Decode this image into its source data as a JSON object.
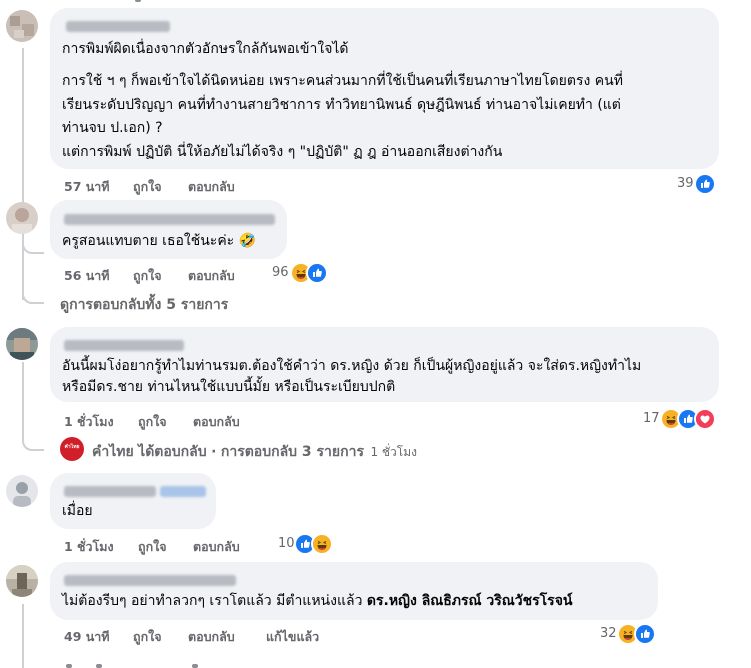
{
  "comments": [
    {
      "lines": [
        "การพิมพ์ผิดเนื่องจากตัวอักษรใกล้กันพอเข้าใจได้",
        "การใช้ ฯ ๆ ก็พอเข้าใจได้นิดหน่อย เพราะคนส่วนมากที่ใช้เป็นคนที่เรียนภาษาไทยโดยตรง คนที่",
        "เรียนระดับปริญญา คนที่ทำงานสายวิชาการ ทำวิทยานิพนธ์ ดุษฎีนิพนธ์ ท่านอาจไม่เคยทำ (แต่",
        "ท่านจบ ป.เอก) ?",
        "แต่การพิมพ์ ปฏิบัติ นี่ให้อภัยไม่ได้จริง ๆ \"ปฏิบัติ\" ฏ ฎ อ่านออกเสียงต่างกัน"
      ],
      "time": "57 นาที",
      "like": "ถูกใจ",
      "reply": "ตอบกลับ",
      "reactions": "39"
    },
    {
      "text": "ครูสอนแทบตาย เธอใช้นะค่ะ 🤣",
      "time": "56 นาที",
      "like": "ถูกใจ",
      "reply": "ตอบกลับ",
      "reactions": "96"
    },
    {
      "lines": [
        "อันนี้ผมโง่อยากรู้ทำไมท่านรมต.ต้องใช้คำว่า ดร.หญิง ด้วย ก็เป็นผู้หญิงอยู่แล้ว จะใส่ดร.หญิงทำไม",
        "หรือมีดร.ชาย ท่านไหนใช้แบบนี้มั้ย หรือเป็นระเบียบปกติ"
      ],
      "time": "1 ชั่วโมง",
      "like": "ถูกใจ",
      "reply": "ตอบกลับ",
      "reactions": "17"
    },
    {
      "text": "เมื่อย",
      "time": "1 ชั่วโมง",
      "like": "ถูกใจ",
      "reply": "ตอบกลับ",
      "reactions": "10"
    },
    {
      "text_plain": "ไม่ต้องรีบๆ อย่าทำลวกๆ เราโตแล้ว มีตำแหน่งแล้ว ",
      "text_bold": "ดร.หญิง ลิณธิภรณ์ วริณวัชรโรจน์",
      "time": "49 นาที",
      "like": "ถูกใจ",
      "reply": "ตอบกลับ",
      "edited": "แก้ไขแล้ว",
      "reactions": "32"
    }
  ],
  "view_replies": "ดูการตอบกลับทั้ง 5 รายการ",
  "page_reply": {
    "avatar_text": "คำไทย",
    "name": "คำไทย",
    "action": "ได้ตอบกลับ",
    "separator": "·",
    "count": "การตอบกลับ 3 รายการ",
    "time": "1 ชั่วโมง"
  },
  "colors": {
    "like_blue": "#1877f2",
    "haha_yellow": "#f7b125",
    "love_red": "#f33e58",
    "muted": "#65676b",
    "bubble": "#f0f2f5"
  }
}
